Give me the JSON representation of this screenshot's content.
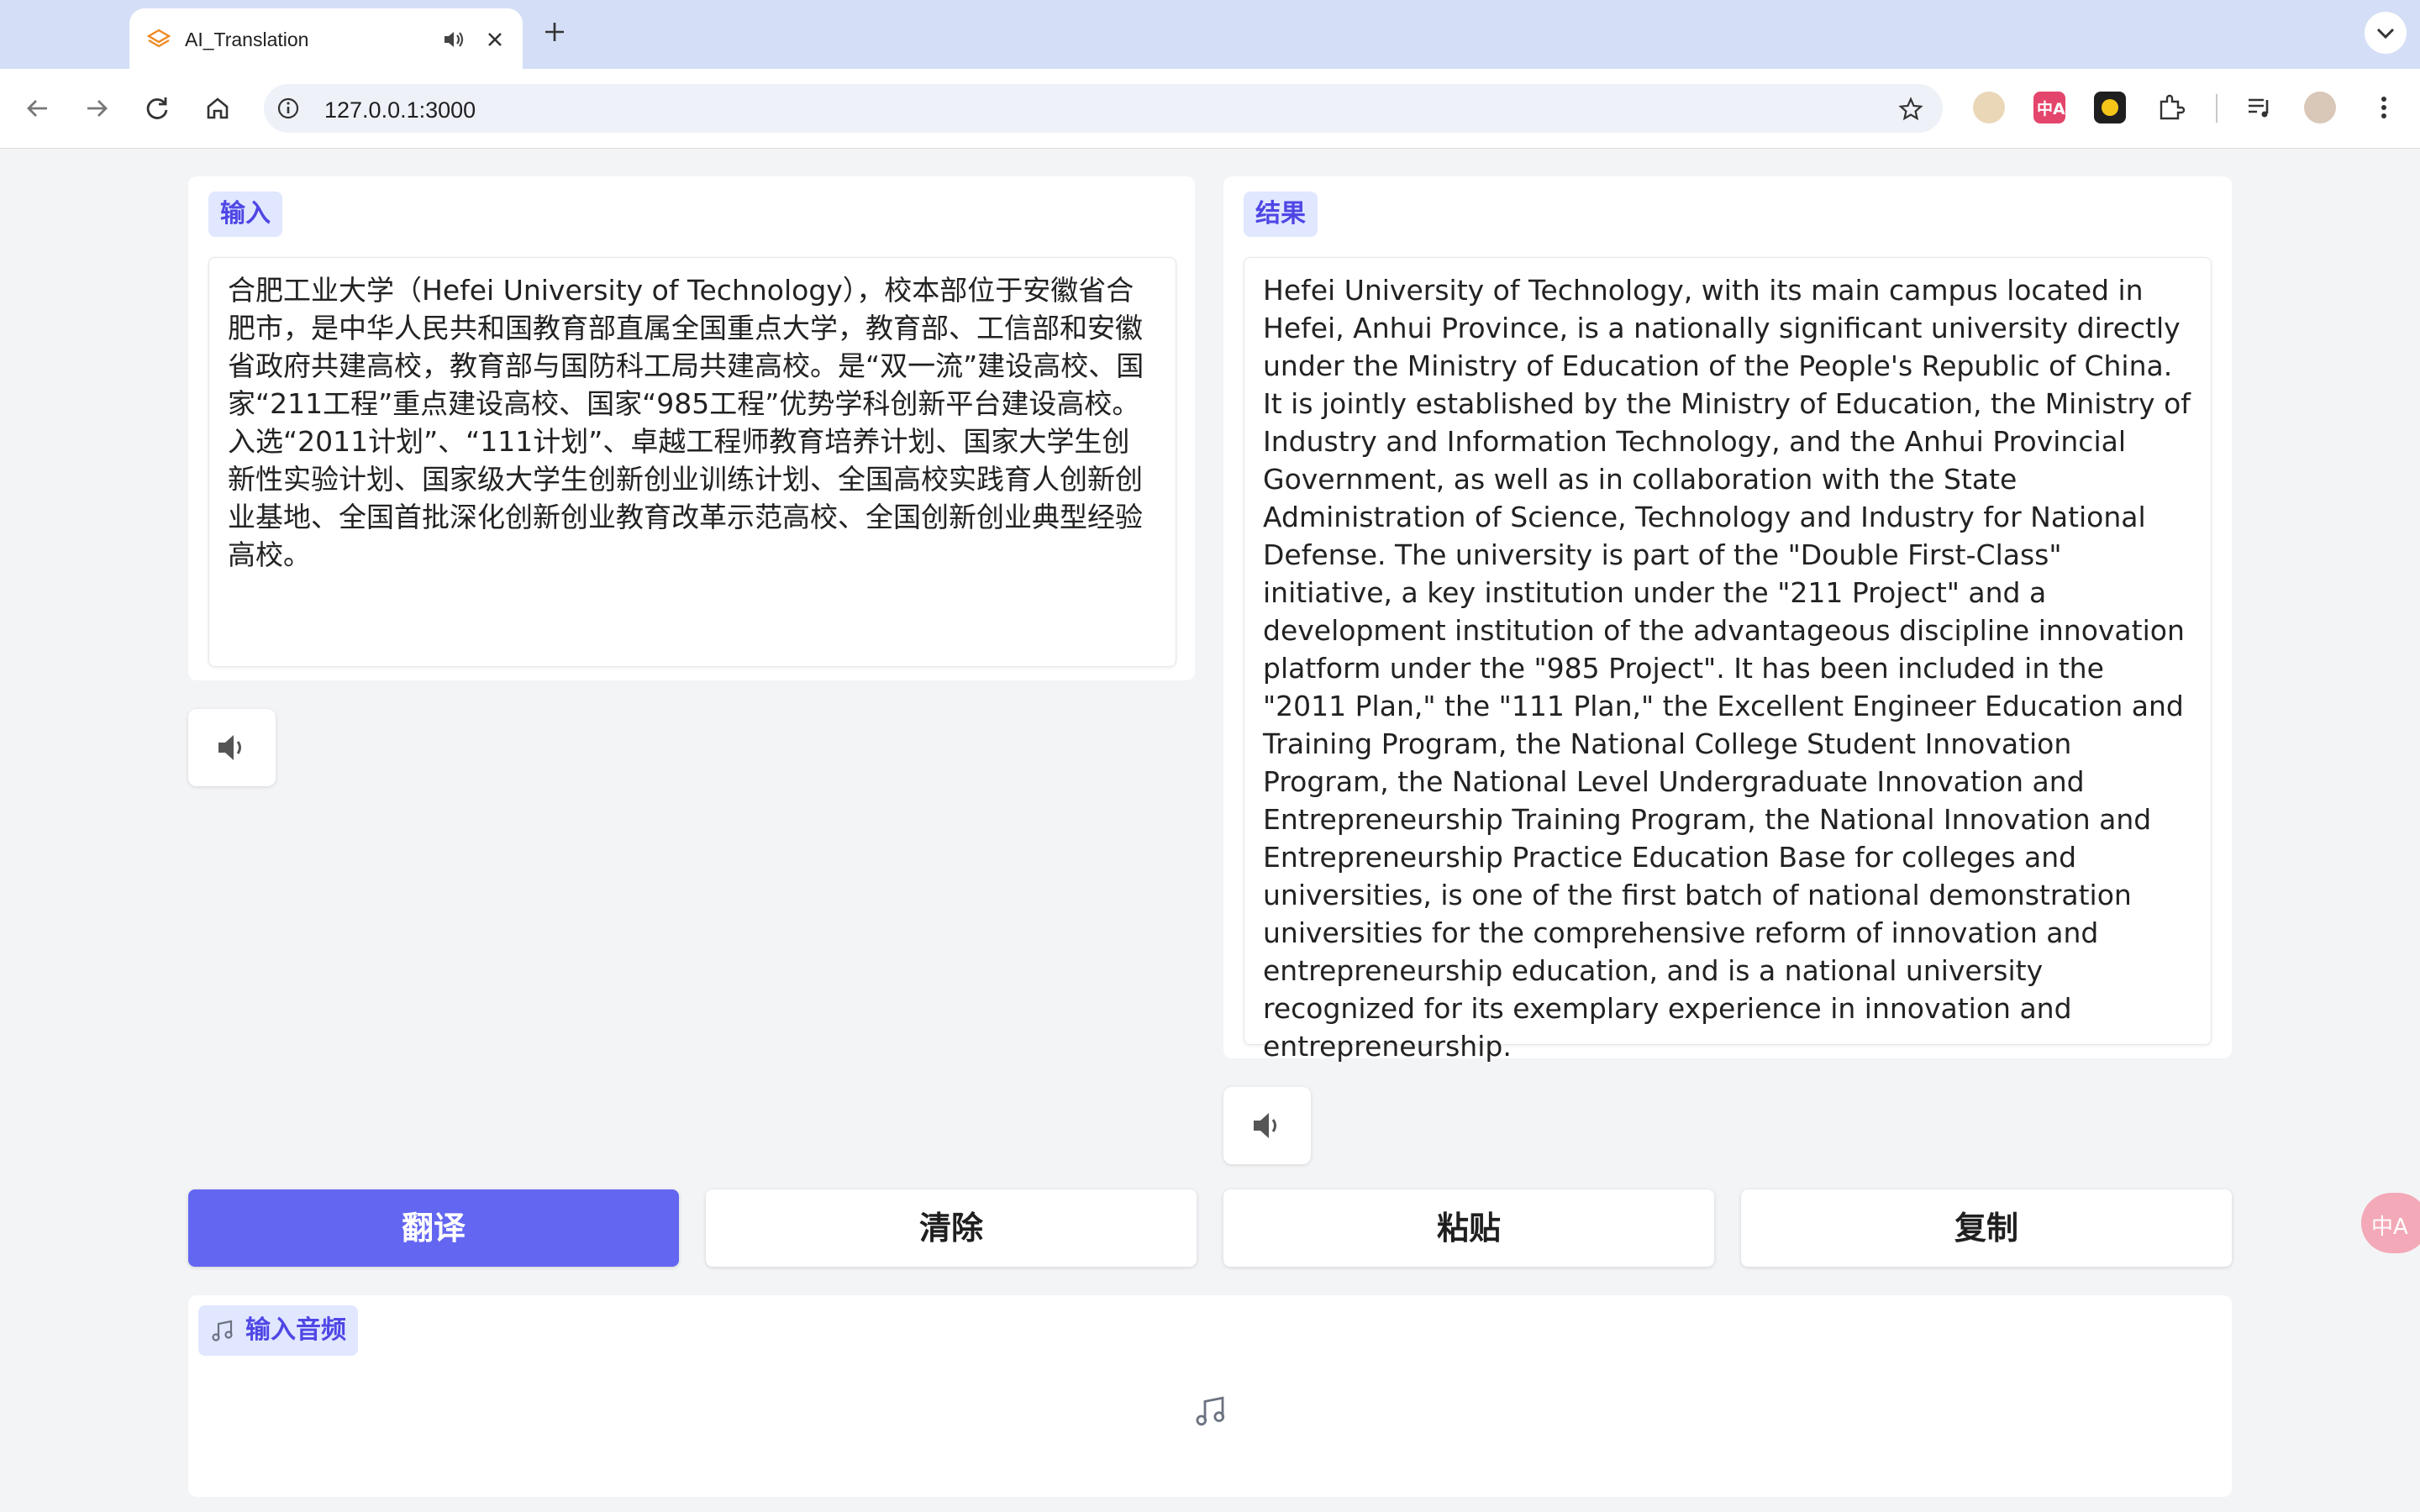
{
  "browser": {
    "tab": {
      "title": "AI_Translation"
    },
    "omnibox": {
      "url": "127.0.0.1:3000"
    },
    "floating_button_label": "中A",
    "extension_labels": [
      "中A"
    ]
  },
  "input": {
    "label": "输入",
    "text": "合肥工业大学（Hefei University of Technology），校本部位于安徽省合肥市，是中华人民共和国教育部直属全国重点大学，教育部、工信部和安徽省政府共建高校，教育部与国防科工局共建高校。是“双一流”建设高校、国家“211工程”重点建设高校、国家“985工程”优势学科创新平台建设高校。 入选“2011计划”、“111计划”、卓越工程师教育培养计划、国家大学生创新性实验计划、国家级大学生创新创业训练计划、全国高校实践育人创新创业基地、全国首批深化创新创业教育改革示范高校、全国创新创业典型经验高校。"
  },
  "result": {
    "label": "结果",
    "text": "Hefei University of Technology, with its main campus located in Hefei, Anhui Province, is a nationally significant university directly under the Ministry of Education of the People's Republic of China. It is jointly established by the Ministry of Education, the Ministry of Industry and Information Technology, and the Anhui Provincial Government, as well as in collaboration with the State Administration of Science, Technology and Industry for National Defense. The university is part of the \"Double First-Class\" initiative, a key institution under the \"211 Project\" and a development institution of the advantageous discipline innovation platform under the \"985 Project\". It has been included in the \"2011 Plan,\" the \"111 Plan,\" the Excellent Engineer Education and Training Program, the National College Student Innovation Program, the National Level Undergraduate Innovation and Entrepreneurship Training Program, the National Innovation and Entrepreneurship Practice Education Base for colleges and universities, is one of the first batch of national demonstration universities for the comprehensive reform of innovation and entrepreneurship education, and is a national university recognized for its exemplary experience in innovation and entrepreneurship."
  },
  "actions": {
    "translate": "翻译",
    "clear": "清除",
    "paste": "粘贴",
    "copy": "复制"
  },
  "audio": {
    "label": "输入音频"
  },
  "colors": {
    "primary": "#6366f1",
    "tag_bg": "#e0e7ff",
    "tag_text": "#4f46e5"
  }
}
